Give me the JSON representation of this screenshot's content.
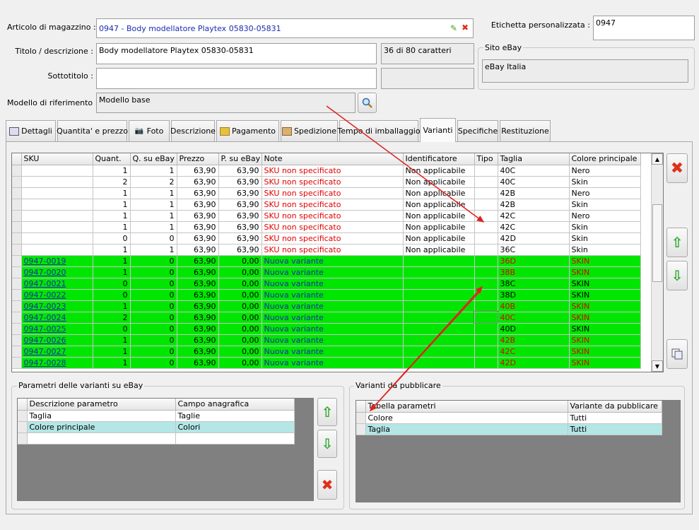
{
  "header": {
    "article_label": "Articolo di magazzino :",
    "article_value": "0947 - Body modellatore Playtex 05830-05831",
    "title_label": "Titolo / descrizione :",
    "title_value": "Body modellatore Playtex 05830-05831",
    "char_count": "36 di 80 caratteri",
    "subtitle_label": "Sottotitolo :",
    "subtitle_value": "",
    "model_label": "Modello di riferimento :",
    "model_value": "Modello base",
    "custom_label": "Etichetta personalizzata :",
    "custom_value": "0947",
    "site_group": "Sito eBay",
    "site_value": "eBay Italia"
  },
  "tabs": [
    {
      "label": "Dettagli",
      "icon": "details-icon"
    },
    {
      "label": "Quantita' e prezzo",
      "icon": ""
    },
    {
      "label": "Foto",
      "icon": "camera-icon"
    },
    {
      "label": "Descrizione",
      "icon": ""
    },
    {
      "label": "Pagamento",
      "icon": "payment-icon"
    },
    {
      "label": "Spedizione",
      "icon": "shipping-icon"
    },
    {
      "label": "Tempo di imballaggio",
      "icon": ""
    },
    {
      "label": "Varianti",
      "icon": ""
    },
    {
      "label": "Specifiche",
      "icon": ""
    },
    {
      "label": "Restituzione",
      "icon": ""
    }
  ],
  "variants_grid": {
    "columns": [
      "SKU",
      "Quant.",
      "Q. su eBay",
      "Prezzo",
      "P. su eBay",
      "Note",
      "Identificatore",
      "Tipo",
      "Taglia",
      "Colore principale"
    ],
    "rows": [
      {
        "sku": "",
        "qty": "1",
        "qebay": "1",
        "price": "63,90",
        "pebay": "63,90",
        "note": "SKU non specificato",
        "ident": "Non applicabile",
        "tipo": "",
        "size": "40C",
        "color": "Nero",
        "green": false
      },
      {
        "sku": "",
        "qty": "2",
        "qebay": "2",
        "price": "63,90",
        "pebay": "63,90",
        "note": "SKU non specificato",
        "ident": "Non applicabile",
        "tipo": "",
        "size": "40C",
        "color": "Skin",
        "green": false
      },
      {
        "sku": "",
        "qty": "1",
        "qebay": "1",
        "price": "63,90",
        "pebay": "63,90",
        "note": "SKU non specificato",
        "ident": "Non applicabile",
        "tipo": "",
        "size": "42B",
        "color": "Nero",
        "green": false
      },
      {
        "sku": "",
        "qty": "1",
        "qebay": "1",
        "price": "63,90",
        "pebay": "63,90",
        "note": "SKU non specificato",
        "ident": "Non applicabile",
        "tipo": "",
        "size": "42B",
        "color": "Skin",
        "green": false
      },
      {
        "sku": "",
        "qty": "1",
        "qebay": "1",
        "price": "63,90",
        "pebay": "63,90",
        "note": "SKU non specificato",
        "ident": "Non applicabile",
        "tipo": "",
        "size": "42C",
        "color": "Nero",
        "green": false
      },
      {
        "sku": "",
        "qty": "1",
        "qebay": "1",
        "price": "63,90",
        "pebay": "63,90",
        "note": "SKU non specificato",
        "ident": "Non applicabile",
        "tipo": "",
        "size": "42C",
        "color": "Skin",
        "green": false
      },
      {
        "sku": "",
        "qty": "0",
        "qebay": "0",
        "price": "63,90",
        "pebay": "63,90",
        "note": "SKU non specificato",
        "ident": "Non applicabile",
        "tipo": "",
        "size": "42D",
        "color": "Skin",
        "green": false
      },
      {
        "sku": "",
        "qty": "1",
        "qebay": "1",
        "price": "63,90",
        "pebay": "63,90",
        "note": "SKU non specificato",
        "ident": "Non applicabile",
        "tipo": "",
        "size": "36C",
        "color": "Skin",
        "green": false
      },
      {
        "sku": "0947-0019",
        "qty": "1",
        "qebay": "0",
        "price": "63,90",
        "pebay": "0,00",
        "note": "Nuova variante",
        "ident": "",
        "tipo": "",
        "size": "36D",
        "color": "SKIN",
        "green": true,
        "redval": true
      },
      {
        "sku": "0947-0020",
        "qty": "1",
        "qebay": "0",
        "price": "63,90",
        "pebay": "0,00",
        "note": "Nuova variante",
        "ident": "",
        "tipo": "",
        "size": "38B",
        "color": "SKIN",
        "green": true,
        "redval": true
      },
      {
        "sku": "0947-0021",
        "qty": "0",
        "qebay": "0",
        "price": "63,90",
        "pebay": "0,00",
        "note": "Nuova variante",
        "ident": "",
        "tipo": "",
        "size": "38C",
        "color": "SKIN",
        "green": true,
        "redval": false
      },
      {
        "sku": "0947-0022",
        "qty": "0",
        "qebay": "0",
        "price": "63,90",
        "pebay": "0,00",
        "note": "Nuova variante",
        "ident": "",
        "tipo": "",
        "size": "38D",
        "color": "SKIN",
        "green": true,
        "redval": false
      },
      {
        "sku": "0947-0023",
        "qty": "1",
        "qebay": "0",
        "price": "63,90",
        "pebay": "0,00",
        "note": "Nuova variante",
        "ident": "",
        "tipo": "",
        "size": "40B",
        "color": "SKIN",
        "green": true,
        "redval": true
      },
      {
        "sku": "0947-0024",
        "qty": "2",
        "qebay": "0",
        "price": "63,90",
        "pebay": "0,00",
        "note": "Nuova variante",
        "ident": "",
        "tipo": "",
        "size": "40C",
        "color": "SKIN",
        "green": true,
        "redval": true
      },
      {
        "sku": "0947-0025",
        "qty": "0",
        "qebay": "0",
        "price": "63,90",
        "pebay": "0,00",
        "note": "Nuova variante",
        "ident": "",
        "tipo": "",
        "size": "40D",
        "color": "SKIN",
        "green": true,
        "redval": false
      },
      {
        "sku": "0947-0026",
        "qty": "1",
        "qebay": "0",
        "price": "63,90",
        "pebay": "0,00",
        "note": "Nuova variante",
        "ident": "",
        "tipo": "",
        "size": "42B",
        "color": "SKIN",
        "green": true,
        "redval": true
      },
      {
        "sku": "0947-0027",
        "qty": "1",
        "qebay": "0",
        "price": "63,90",
        "pebay": "0,00",
        "note": "Nuova variante",
        "ident": "",
        "tipo": "",
        "size": "42C",
        "color": "SKIN",
        "green": true,
        "redval": true
      },
      {
        "sku": "0947-0028",
        "qty": "1",
        "qebay": "0",
        "price": "63,90",
        "pebay": "0,00",
        "note": "Nuova variante",
        "ident": "",
        "tipo": "",
        "size": "42D",
        "color": "SKIN",
        "green": true,
        "redval": true
      }
    ]
  },
  "params_panel": {
    "title": "Parametri delle varianti su eBay",
    "columns": [
      "Descrizione parametro",
      "Campo anagrafica"
    ],
    "rows": [
      {
        "desc": "Taglia",
        "field": "Taglie"
      },
      {
        "desc": "Colore principale",
        "field": "Colori"
      }
    ]
  },
  "publish_panel": {
    "title": "Varianti da pubblicare",
    "columns": [
      "Tabella parametri",
      "Variante da pubblicare"
    ],
    "rows": [
      {
        "table": "Colore",
        "variant": "Tutti"
      },
      {
        "table": "Taglia",
        "variant": "Tutti"
      }
    ]
  },
  "colors": {
    "green_row": "#00e600",
    "accent_red": "#e00000",
    "selected_row": "#b4e6e6"
  }
}
